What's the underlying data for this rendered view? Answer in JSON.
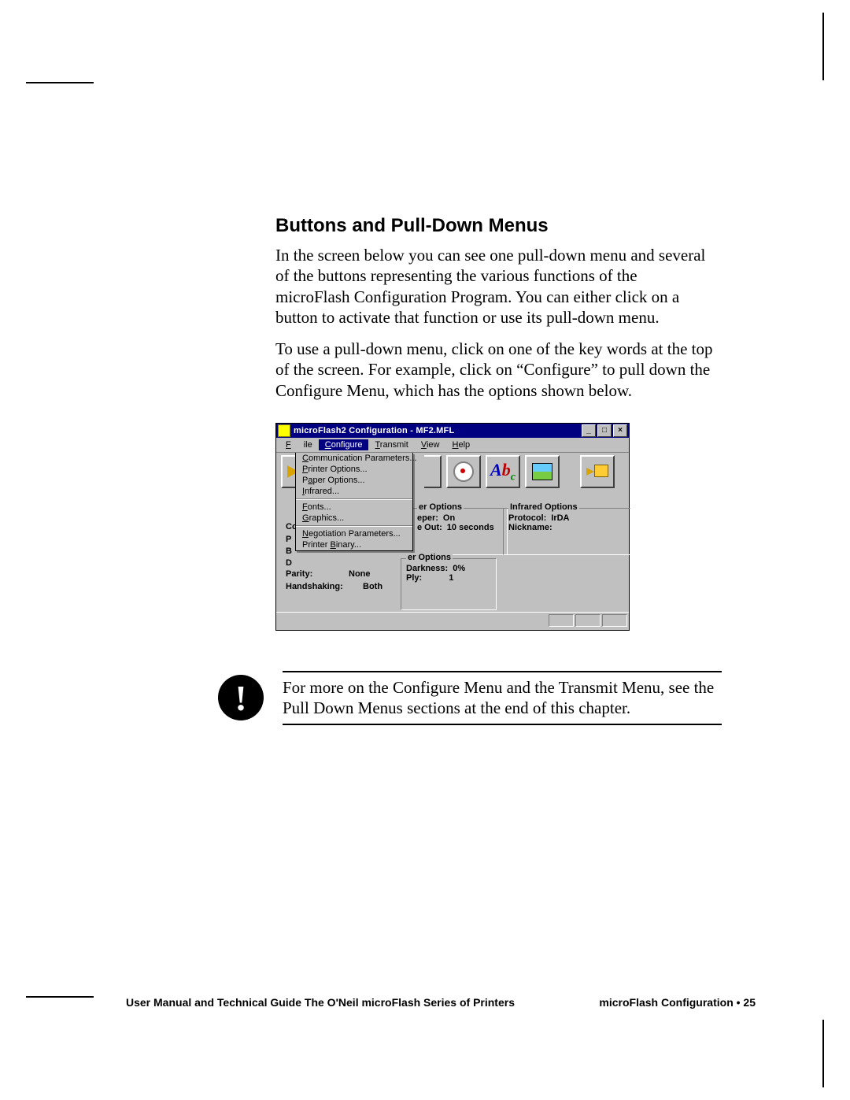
{
  "heading": "Buttons and Pull-Down Menus",
  "para1": "In the screen below you can see one pull-down menu and several of the buttons representing the various functions of the microFlash Configuration Program. You can either click on a button to activate that function or use its pull-down menu.",
  "para2": "To use a pull-down menu, click on one of the key words at the top of the screen. For example, click on “Configure” to pull down the Configure Menu, which has the options shown below.",
  "note": "For more on the Configure Menu and the Transmit Menu, see the Pull Down Menus sections at the end of this chapter.",
  "footer_left": "User Manual and Technical Guide The O'Neil microFlash Series of Printers",
  "footer_right": "microFlash Configuration • 25",
  "win": {
    "title": "microFlash2 Configuration - MF2.MFL",
    "min": "_",
    "max": "□",
    "close": "×",
    "menu": {
      "file": "File",
      "configure": "Configure",
      "transmit": "Transmit",
      "view": "View",
      "help": "Help"
    },
    "dropdown": {
      "comm": "Communication Parameters...",
      "printer": "Printer Options...",
      "paper": "Paper Options...",
      "infrared": "Infrared...",
      "fonts": "Fonts...",
      "graphics": "Graphics...",
      "negot": "Negotiation Parameters...",
      "binary": "Printer Binary..."
    },
    "leftfrag": {
      "co": "Co",
      "p": "P",
      "b": "B",
      "d": "D",
      "parity": "Parity:",
      "parity_v": "None",
      "handshaking": "Handshaking:",
      "handshaking_v": "Both"
    },
    "paper": {
      "legend": "er Options",
      "beeper": "eper:",
      "beeper_v": "On",
      "timeout": "e Out:",
      "timeout_v": "10 seconds"
    },
    "ir": {
      "legend": "Infrared Options",
      "protocol": "Protocol:",
      "protocol_v": "IrDA",
      "nickname": "Nickname:"
    },
    "printer": {
      "legend": "er Options",
      "darkness": "Darkness:",
      "darkness_v": "0%",
      "ply": "Ply:",
      "ply_v": "1"
    }
  }
}
